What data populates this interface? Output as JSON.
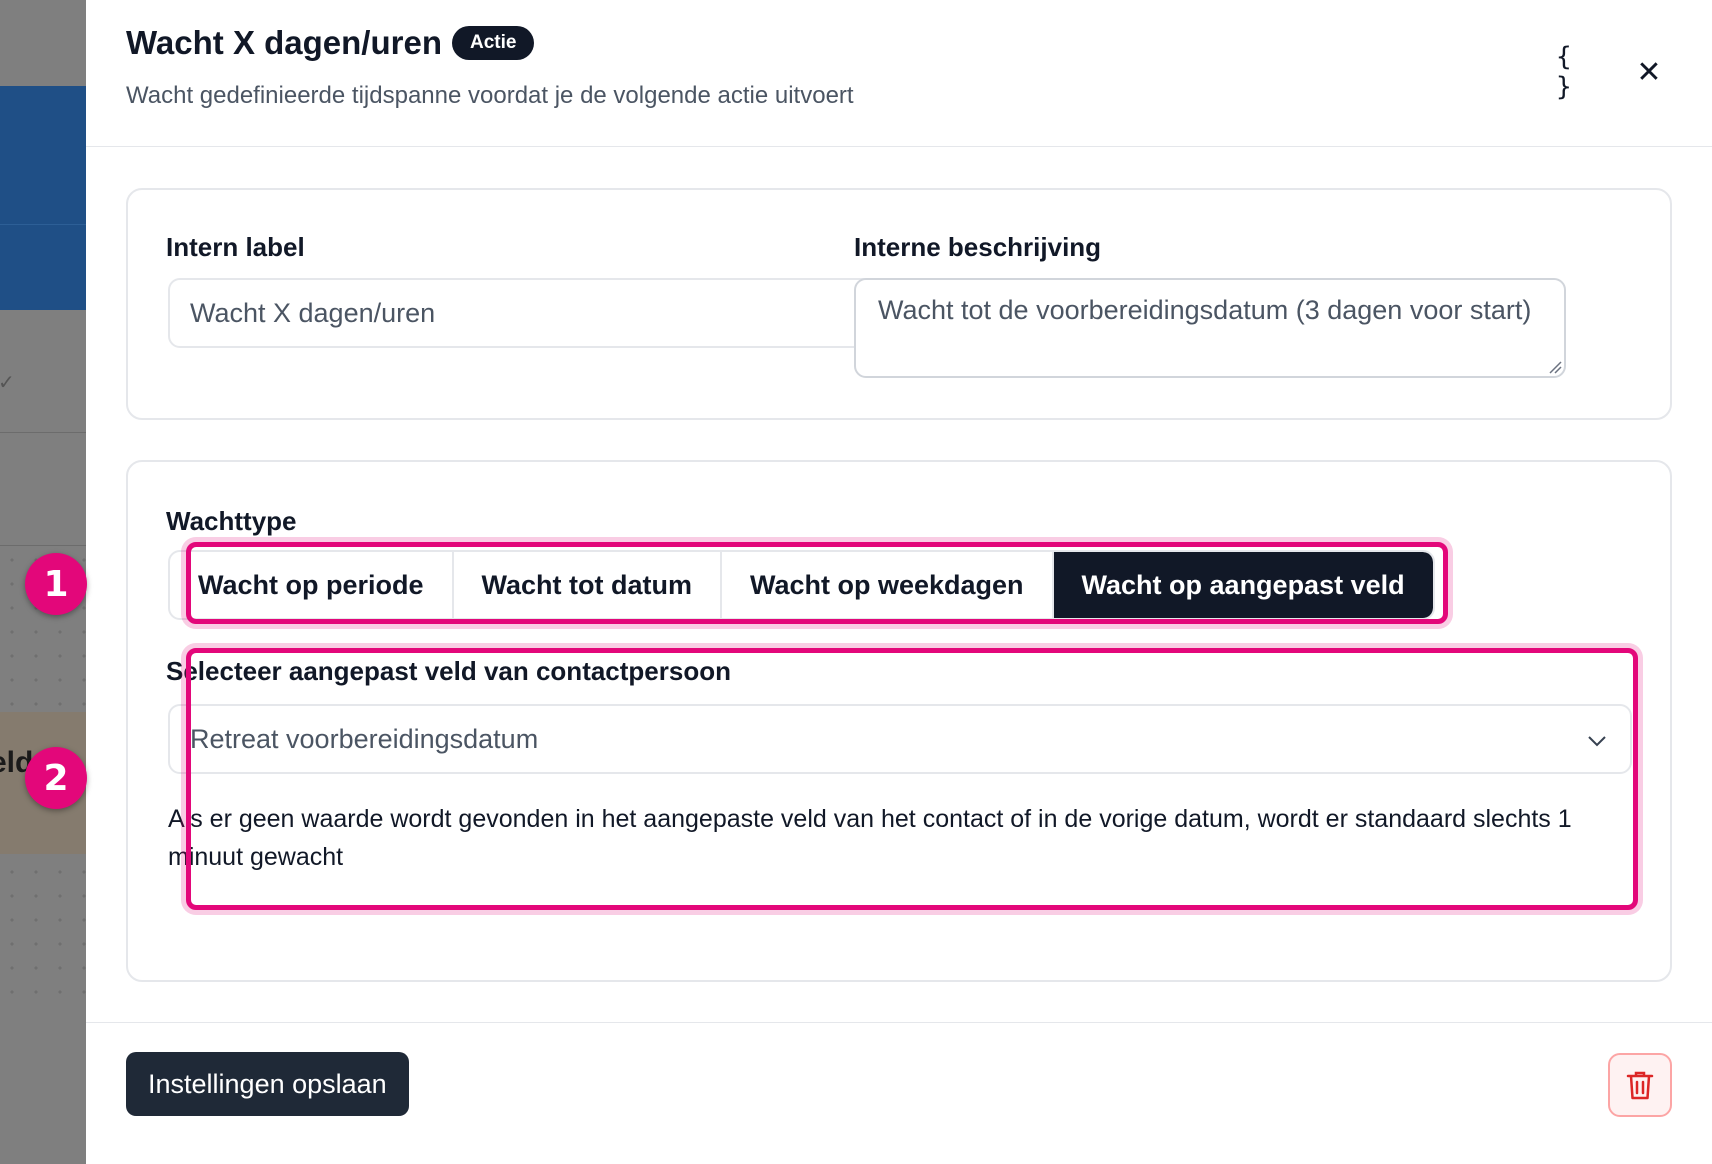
{
  "background": {
    "partial_text": "eld"
  },
  "header": {
    "title": "Wacht X dagen/uren",
    "badge": "Actie",
    "subtitle": "Wacht gedefinieerde tijdspanne voordat je de volgende actie uitvoert",
    "json_icon": "{ }",
    "close_icon": "✕"
  },
  "general": {
    "label_title": "Intern label",
    "label_value": "Wacht X dagen/uren",
    "description_title": "Interne beschrijving",
    "description_value": "Wacht tot de voorbereidingsdatum (3 dagen voor start)"
  },
  "wait": {
    "type_title": "Wachttype",
    "options": [
      {
        "label": "Wacht op periode",
        "active": false
      },
      {
        "label": "Wacht tot datum",
        "active": false
      },
      {
        "label": "Wacht op weekdagen",
        "active": false
      },
      {
        "label": "Wacht op aangepast veld",
        "active": true
      }
    ],
    "field_title": "Selecteer aangepast veld van contactpersoon",
    "field_value": "Retreat voorbereidingsdatum",
    "help_text": "Als er geen waarde wordt gevonden in het aangepaste veld van het contact of in de vorige datum, wordt er standaard slechts 1 minuut gewacht"
  },
  "footer": {
    "save_label": "Instellingen opslaan",
    "delete_icon": "trash-icon"
  },
  "annotations": {
    "marker_1": "1",
    "marker_2": "2"
  },
  "colors": {
    "highlight": "#e3077a",
    "primary_dark": "#111827",
    "danger": "#dc2626"
  }
}
